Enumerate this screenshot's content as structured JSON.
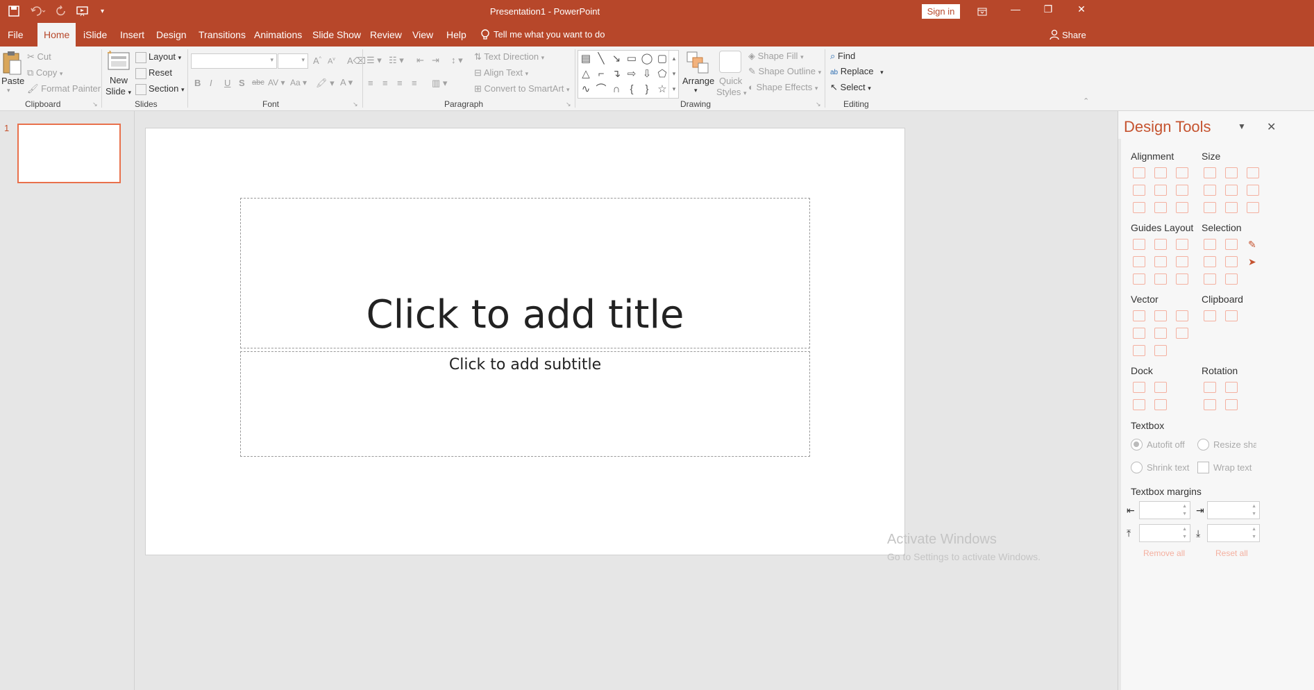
{
  "app": {
    "title": "Presentation1  -  PowerPoint",
    "sign_in": "Sign in",
    "share": "Share"
  },
  "qat": {
    "save_icon": "save-icon",
    "undo_icon": "undo-icon",
    "redo_icon": "redo-icon",
    "present_icon": "present-icon",
    "customize_icon": "chevron-down-icon"
  },
  "tabs": [
    {
      "label": "File"
    },
    {
      "label": "Home"
    },
    {
      "label": "iSlide"
    },
    {
      "label": "Insert"
    },
    {
      "label": "Design"
    },
    {
      "label": "Transitions"
    },
    {
      "label": "Animations"
    },
    {
      "label": "Slide Show"
    },
    {
      "label": "Review"
    },
    {
      "label": "View"
    },
    {
      "label": "Help"
    }
  ],
  "tell_me": "Tell me what you want to do",
  "ribbon": {
    "clipboard": {
      "label": "Clipboard",
      "paste": "Paste",
      "cut": "Cut",
      "copy": "Copy",
      "format_painter": "Format Painter"
    },
    "slides": {
      "label": "Slides",
      "new_slide_1": "New",
      "new_slide_2": "Slide",
      "layout": "Layout",
      "reset": "Reset",
      "section": "Section"
    },
    "font": {
      "label": "Font",
      "font_name": "",
      "font_size": ""
    },
    "paragraph": {
      "label": "Paragraph",
      "text_direction": "Text Direction",
      "align_text": "Align Text",
      "convert_smartart": "Convert to SmartArt"
    },
    "drawing": {
      "label": "Drawing",
      "arrange": "Arrange",
      "quick_styles_1": "Quick",
      "quick_styles_2": "Styles",
      "shape_fill": "Shape Fill",
      "shape_outline": "Shape Outline",
      "shape_effects": "Shape Effects"
    },
    "editing": {
      "label": "Editing",
      "find": "Find",
      "replace": "Replace",
      "select": "Select"
    }
  },
  "thumbnails": [
    {
      "number": "1"
    }
  ],
  "slide": {
    "title_placeholder": "Click to add title",
    "subtitle_placeholder": "Click to add subtitle"
  },
  "design_tools": {
    "title": "Design Tools",
    "sections": {
      "alignment": "Alignment",
      "size": "Size",
      "guides_layout": "Guides Layout",
      "selection": "Selection",
      "vector": "Vector",
      "clipboard": "Clipboard",
      "dock": "Dock",
      "rotation": "Rotation",
      "textbox": "Textbox",
      "textbox_margins": "Textbox margins"
    },
    "textbox_options": {
      "autofit_off": "Autofit off",
      "resize_shape": "Resize sha",
      "shrink_text": "Shrink text",
      "wrap_text": "Wrap text"
    },
    "remove_all": "Remove all",
    "reset_all": "Reset all"
  },
  "watermark": {
    "line1": "Activate Windows",
    "line2": "Go to Settings to activate Windows."
  },
  "colors": {
    "accent": "#b7472a",
    "panel_title": "#c5532f",
    "thumb_border": "#e8704b"
  }
}
